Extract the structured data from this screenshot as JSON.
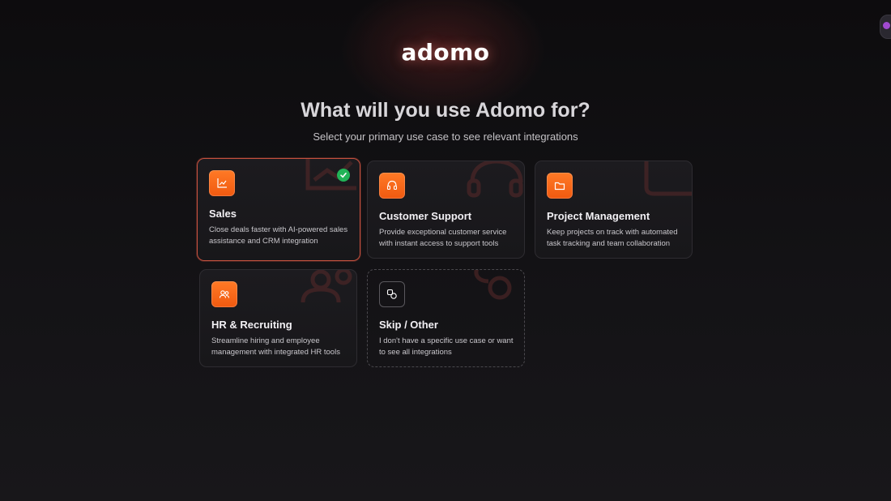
{
  "brand": {
    "logo_text": "adomo"
  },
  "header": {
    "title": "What will you use Adomo for?",
    "subtitle": "Select your primary use case to see relevant integrations"
  },
  "accent_color": "#f26a1b",
  "selected_color": "#c6513f",
  "check_color": "#22b357",
  "cards": [
    {
      "icon": "chart-line-icon",
      "title": "Sales",
      "description": "Close deals faster with AI-powered sales assistance and CRM integration",
      "selected": true
    },
    {
      "icon": "headset-icon",
      "title": "Customer Support",
      "description": "Provide exceptional customer service with instant access to support tools",
      "selected": false
    },
    {
      "icon": "folder-icon",
      "title": "Project Management",
      "description": "Keep projects on track with automated task tracking and team collaboration",
      "selected": false
    },
    {
      "icon": "users-icon",
      "title": "HR & Recruiting",
      "description": "Streamline hiring and employee management with integrated HR tools",
      "selected": false
    },
    {
      "icon": "shapes-icon",
      "title": "Skip / Other",
      "description": "I don't have a specific use case or want to see all integrations",
      "selected": false
    }
  ]
}
